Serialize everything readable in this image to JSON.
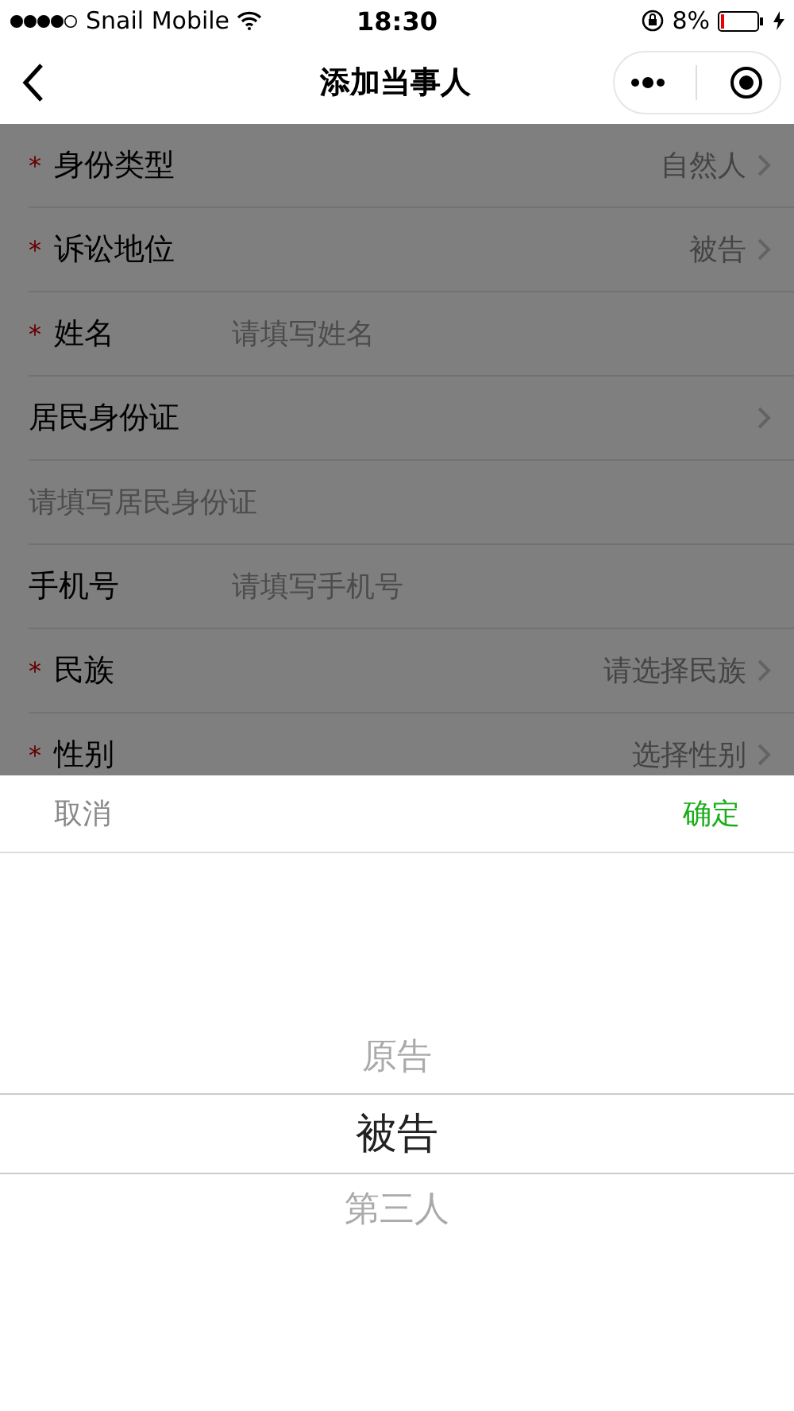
{
  "status_bar": {
    "carrier": "Snail Mobile",
    "time": "18:30",
    "battery": "8%"
  },
  "nav": {
    "title": "添加当事人"
  },
  "form": {
    "rows": [
      {
        "kind": "select",
        "required_mark": "*",
        "label": "身份类型",
        "value": "自然人"
      },
      {
        "kind": "select",
        "required_mark": "*",
        "label": "诉讼地位",
        "value": "被告"
      },
      {
        "kind": "input",
        "required_mark": "*",
        "label": "姓名",
        "placeholder": "请填写姓名"
      },
      {
        "kind": "select",
        "label": "居民身份证"
      },
      {
        "kind": "input_full",
        "placeholder": "请填写居民身份证"
      },
      {
        "kind": "input",
        "label": "手机号",
        "placeholder": "请填写手机号"
      },
      {
        "kind": "select",
        "required_mark": "*",
        "label": "民族",
        "value": "请选择民族"
      },
      {
        "kind": "select",
        "required_mark": "*",
        "label": "性别",
        "value": "选择性别"
      }
    ]
  },
  "picker": {
    "cancel": "取消",
    "confirm": "确定",
    "options": [
      {
        "label": "原告",
        "selected": false
      },
      {
        "label": "被告",
        "selected": true
      },
      {
        "label": "第三人",
        "selected": false
      }
    ]
  }
}
